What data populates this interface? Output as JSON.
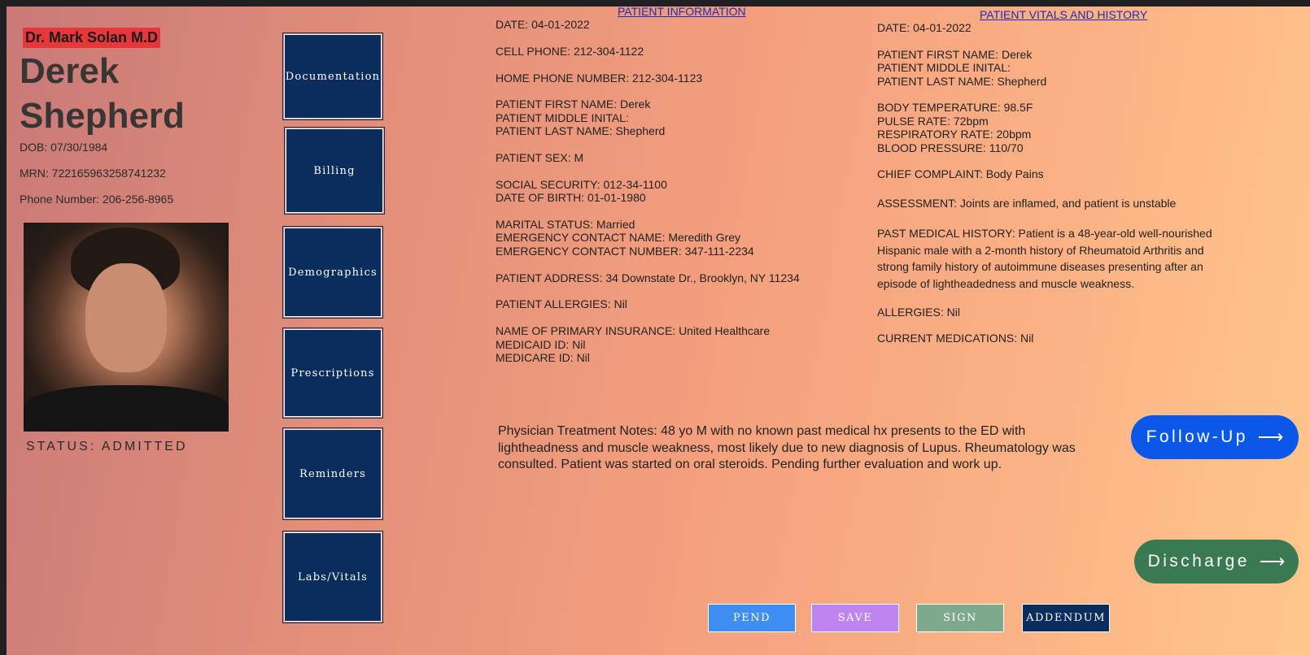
{
  "doctor": "Dr. Mark Solan M.D",
  "patient": {
    "first": "Derek",
    "last": "Shepherd",
    "dob": "DOB: 07/30/1984",
    "mrn": "MRN: 722165963258741232",
    "phone": "Phone Number: 206-256-8965",
    "status": "STATUS: ADMITTED"
  },
  "nav": [
    "Documentation",
    "Billing",
    "Demographics",
    "Prescriptions",
    "Reminders",
    "Labs/Vitals"
  ],
  "info": {
    "title": "PATIENT INFORMATION",
    "date": "DATE: 04-01-2022",
    "cell": "CELL PHONE: 212-304-1122",
    "home": "HOME PHONE NUMBER: 212-304-1123",
    "first": "PATIENT FIRST NAME: Derek",
    "middle": "PATIENT MIDDLE INITAL:",
    "last": "PATIENT LAST NAME: Shepherd",
    "sex": "PATIENT SEX: M",
    "ssn": "SOCIAL SECURITY: 012-34-1100",
    "birth": "DATE OF BIRTH: 01-01-1980",
    "marital": "MARITAL STATUS: Married",
    "emergency_name": "EMERGENCY CONTACT NAME: Meredith Grey",
    "emergency_number": "EMERGENCY CONTACT NUMBER: 347-111-2234",
    "address": "PATIENT ADDRESS: 34 Downstate Dr., Brooklyn, NY 11234",
    "allergies": "PATIENT ALLERGIES: Nil",
    "insurance": "NAME OF PRIMARY INSURANCE: United Healthcare",
    "medicaid": "MEDICAID ID: Nil",
    "medicare": "MEDICARE ID: Nil"
  },
  "vitals": {
    "title": "PATIENT VITALS AND HISTORY",
    "date": "DATE: 04-01-2022",
    "first": "PATIENT FIRST NAME: Derek",
    "middle": "PATIENT MIDDLE INITAL:",
    "last": "PATIENT LAST NAME: Shepherd",
    "temp": "BODY TEMPERATURE: 98.5F",
    "pulse": "PULSE RATE: 72bpm",
    "resp": "RESPIRATORY RATE: 20bpm",
    "bp": "BLOOD PRESSURE: 110/70",
    "complaint": "CHIEF COMPLAINT: Body Pains",
    "assessment": "ASSESSMENT: Joints are inflamed, and patient is unstable",
    "history_1": "PAST MEDICAL HISTORY: Patient is a 48-year-old well-nourished",
    "history_2": "Hispanic male with a 2-month history of Rheumatoid Arthritis and",
    "history_3": "strong family history of autoimmune diseases presenting after an",
    "history_4": "episode of lightheadedness and muscle weakness.",
    "allergies": "ALLERGIES: Nil",
    "medications": "CURRENT MEDICATIONS: Nil"
  },
  "notes": {
    "line1": "Physician Treatment Notes: 48 yo M with no known past medical hx presents to the ED with",
    "line2": "lightheadness and muscle weakness, most likely due to new diagnosis of Lupus. Rheumatology was",
    "line3": "consulted. Patient was started on oral steroids. Pending further evaluation and work up."
  },
  "followup": {
    "label": "Follow-Up",
    "arrow": "⟶",
    "color": "#0a57e8"
  },
  "discharge": {
    "label": "Discharge",
    "arrow": "⟶",
    "color": "#3a7a52"
  },
  "actions": [
    {
      "label": "PEND",
      "color": "#3f8ff2"
    },
    {
      "label": "SAVE",
      "color": "#be84f0"
    },
    {
      "label": "SIGN",
      "color": "#7fa98c"
    },
    {
      "label": "ADDENDUM",
      "color": "#0b2d5e"
    }
  ],
  "colors": {
    "nav_bg": "#0b2d5e",
    "doctor_badge": "#e8373b",
    "link": "#1d2db8"
  }
}
